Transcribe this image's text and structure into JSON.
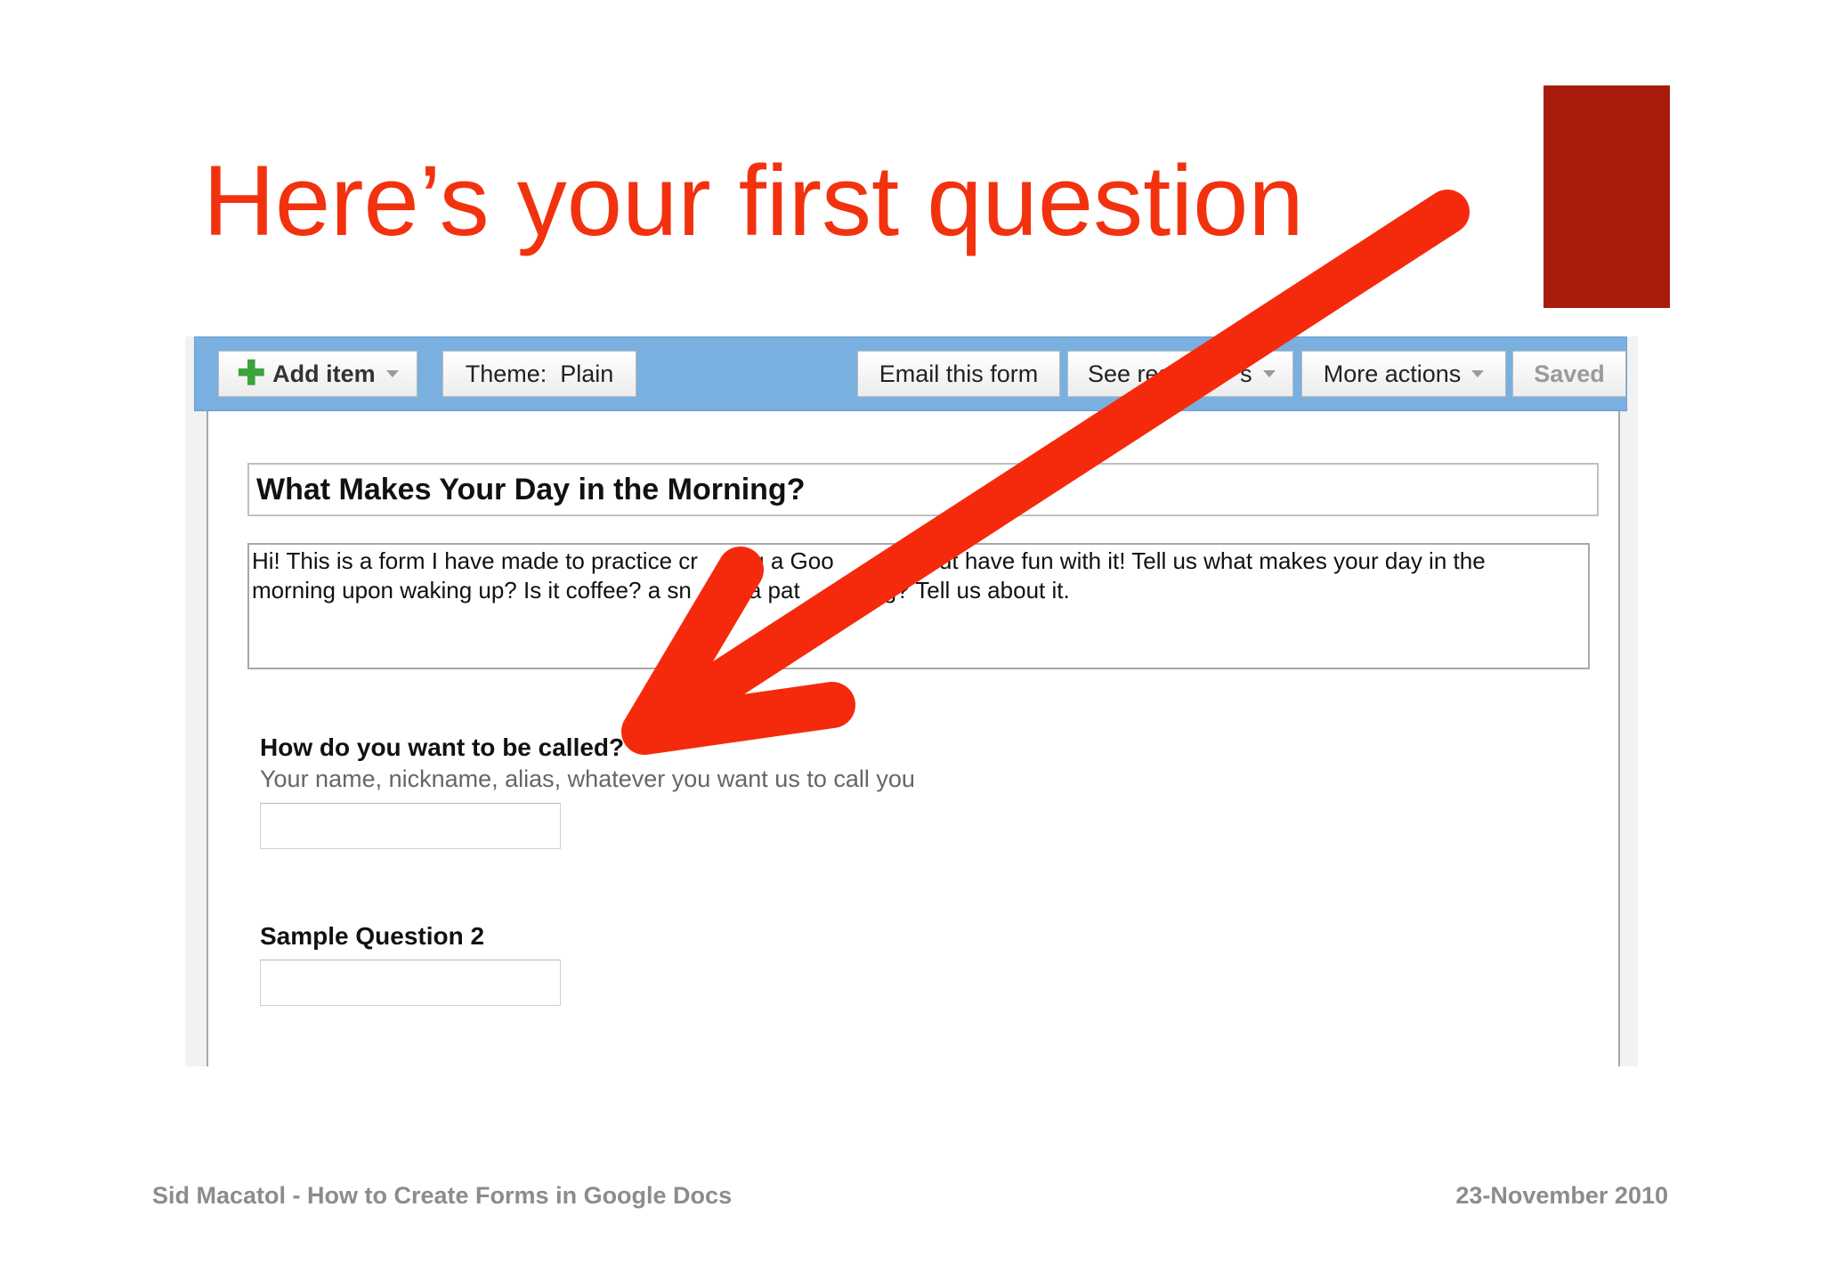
{
  "slide": {
    "title": "Here’s your first question",
    "footer_left": "Sid Macatol - How to Create Forms in Google Docs",
    "footer_right": "23-November 2010"
  },
  "toolbar": {
    "add_item": "Add item",
    "theme": "Theme:  Plain",
    "email_form": "Email this form",
    "see_responses": "See res",
    "see_responses_tail": "s",
    "more_actions": "More actions",
    "saved": "Saved"
  },
  "form": {
    "title": "What Makes Your Day in the Morning?",
    "description_line1": "Hi! This is a form I have made to practice cr",
    "description_line1b": "ing a Goo",
    "description_line1c": "n. But have fun with it! Tell us what makes your day in the",
    "description_line2": "morning upon waking up? Is it coffee? a sn",
    "description_line2b": "a pat",
    "description_line2c": "eting? Tell us about it.",
    "questions": [
      {
        "title": "How do you want to be called?",
        "required_mark": "*",
        "help": "Your name, nickname, alias, whatever you want us to call you"
      },
      {
        "title": "Sample Question 2"
      }
    ]
  },
  "colors": {
    "title_red": "#f2320f",
    "accent_block": "#a91b0d",
    "toolbar_blue": "#79b0e0",
    "arrow_red": "#f52a0c"
  },
  "icons": {
    "add": "plus-icon",
    "dropdown": "caret-down-icon",
    "annotation": "arrow-annotation"
  }
}
